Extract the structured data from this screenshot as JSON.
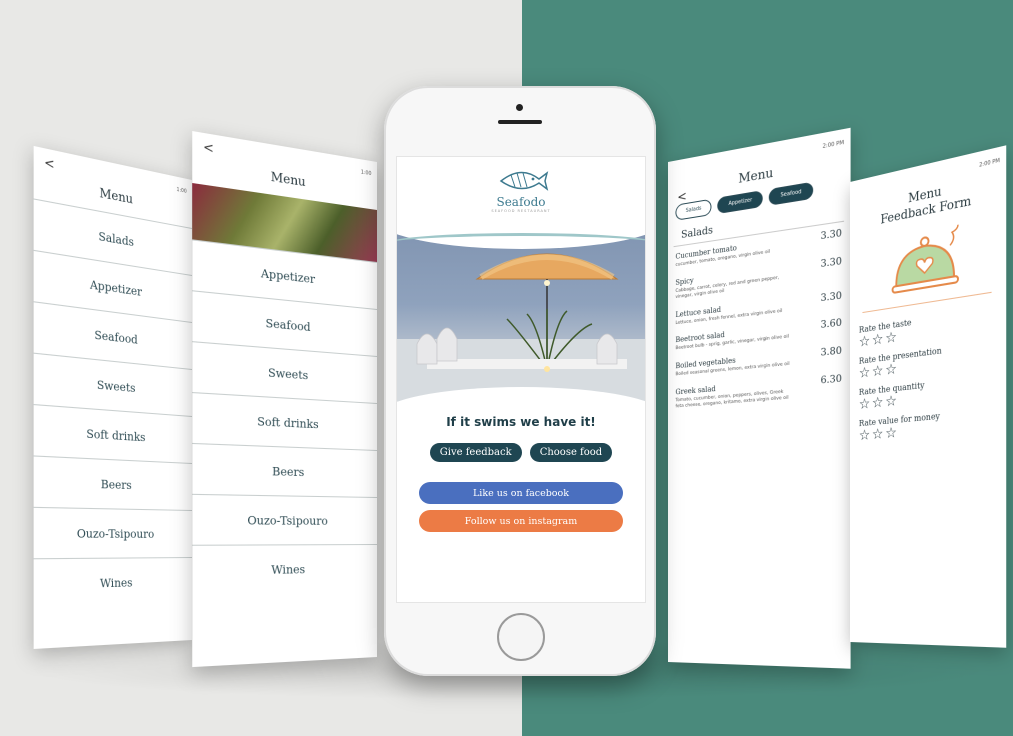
{
  "menu_screen_1": {
    "back_label": "<",
    "title": "Menu",
    "status_time": "1:00",
    "items": [
      "Salads",
      "Appetizer",
      "Seafood",
      "Sweets",
      "Soft drinks",
      "Beers",
      "Ouzo-Tsipouro",
      "Wines"
    ]
  },
  "menu_screen_2": {
    "back_label": "<",
    "title": "Menu",
    "status_time": "1:00",
    "items": [
      "Appetizer",
      "Seafood",
      "Sweets",
      "Soft drinks",
      "Beers",
      "Ouzo-Tsipouro",
      "Wines"
    ]
  },
  "home_screen": {
    "brand": "Seafodo",
    "brand_sub": "SEAFOOD RESTAURANT",
    "tagline": "If it swims we have it!",
    "give_feedback_label": "Give feedback",
    "choose_food_label": "Choose food",
    "facebook_label": "Like us on facebook",
    "instagram_label": "Follow us on instagram"
  },
  "dish_screen": {
    "back_label": "<",
    "title": "Menu",
    "status_time": "2:00 PM",
    "tabs": [
      "Salads",
      "Appetizer",
      "Seafood"
    ],
    "category": "Salads",
    "dishes": [
      {
        "name": "Cucumber tomato",
        "desc": "cucumber, tomato, oregano, virgin olive oil",
        "price": "3.30"
      },
      {
        "name": "Spicy",
        "desc": "Cabbage, carrot, celery, red and green pepper, vinegar, virgin olive oil",
        "price": "3.30"
      },
      {
        "name": "Lettuce salad",
        "desc": "Lettuce, onion, fresh fennel, extra virgin olive oil",
        "price": "3.30"
      },
      {
        "name": "Beetroot salad",
        "desc": "Beetroot bulb - sprig, garlic, vinegar, virgin olive oil",
        "price": "3.60"
      },
      {
        "name": "Boiled vegetables",
        "desc": "Boiled seasonal greens, lemon, extra virgin olive oil",
        "price": "3.80"
      },
      {
        "name": "Greek salad",
        "desc": "Tomato, cucumber, onion, peppers, olives, Greek feta cheese, oregano, kritamo, extra virgin olive oil",
        "price": "6.30"
      }
    ]
  },
  "feedback_screen": {
    "status_time": "2:00 PM",
    "title_line1": "Menu",
    "title_line2": "Feedback Form",
    "rates": [
      {
        "label": "Rate the taste",
        "stars": "☆☆☆"
      },
      {
        "label": "Rate the presentation",
        "stars": "☆☆☆"
      },
      {
        "label": "Rate the quantity",
        "stars": "☆☆☆"
      },
      {
        "label": "Rate value for money",
        "stars": "☆☆☆"
      }
    ]
  },
  "colors": {
    "teal_bg": "#4a8a7c",
    "dark_button": "#1f4652",
    "facebook": "#4a6fbf",
    "instagram": "#ec7b45",
    "feedback_icon_green": "#b9d9a3",
    "feedback_icon_orange": "#e58a4a"
  }
}
